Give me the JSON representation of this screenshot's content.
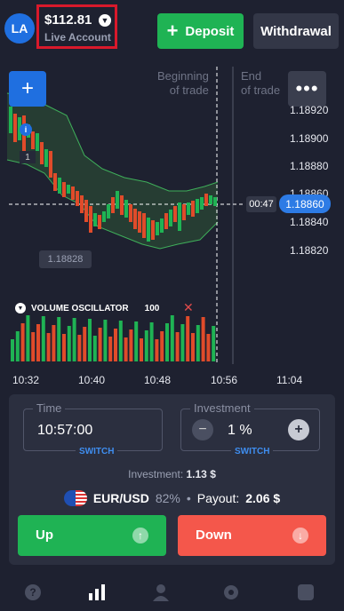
{
  "header": {
    "avatar_initials": "LA",
    "balance": "$112.81",
    "account_type": "Live Account",
    "deposit_label": "Deposit",
    "withdrawal_label": "Withdrawal"
  },
  "chart": {
    "trade_start_label": [
      "Beginning",
      "of trade"
    ],
    "trade_end_label": [
      "End",
      "of trade"
    ],
    "price_labels": [
      "1.18920",
      "1.18900",
      "1.18880",
      "1.18860",
      "1.18840",
      "1.18820"
    ],
    "current_price": "1.18860",
    "timer": "00:47",
    "hover_price": "1.18828",
    "marker_count": "1",
    "time_labels": [
      "10:32",
      "10:40",
      "10:48",
      "10:56",
      "11:04"
    ],
    "oscillator": {
      "name": "VOLUME OSCILLATOR",
      "period": "100"
    },
    "colors": {
      "bull": "#1fb354",
      "bear": "#e04b2a",
      "band": "#2d6b3a"
    }
  },
  "trade_panel": {
    "time_label": "Time",
    "time_value": "10:57:00",
    "time_switch": "SWITCH",
    "investment_label": "Investment",
    "investment_value": "1 %",
    "investment_switch": "SWITCH",
    "investment_summary_label": "Investment:",
    "investment_summary_value": "1.13 $",
    "asset": "EUR/USD",
    "asset_percent": "82%",
    "payout_label": "Payout:",
    "payout_value": "2.06 $",
    "up_label": "Up",
    "down_label": "Down"
  },
  "nav": {
    "icons": [
      "help-icon",
      "chart-icon",
      "profile-icon",
      "settings-icon",
      "square-icon"
    ]
  }
}
